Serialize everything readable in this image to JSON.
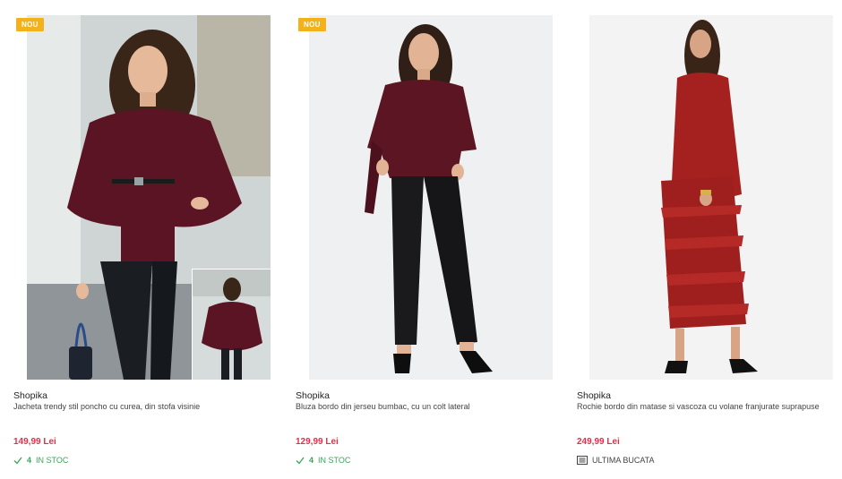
{
  "products": [
    {
      "badge": "NOU",
      "brand": "Shopika",
      "title": "Jacheta trendy stil poncho cu curea, din stofa visinie",
      "price": "149,99 Lei",
      "stock_count": "4",
      "stock_label": "IN STOC",
      "stock_icon": "check-icon"
    },
    {
      "badge": "NOU",
      "brand": "Shopika",
      "title": "Bluza bordo din jerseu bumbac, cu un colt lateral",
      "price": "129,99 Lei",
      "stock_count": "4",
      "stock_label": "IN STOC",
      "stock_icon": "check-icon"
    },
    {
      "brand": "Shopika",
      "title": "Rochie bordo din matase si vascoza cu volane franjurate suprapuse",
      "price": "249,99 Lei",
      "stock_label": "ULTIMA BUCATA",
      "stock_icon": "list-icon"
    }
  ],
  "colors": {
    "badge": "#f3b21b",
    "price": "#e0304c",
    "in_stock": "#3aa655",
    "garment_1": "#5a1424",
    "garment_2": "#5c1522",
    "garment_3": "#a5211f"
  }
}
